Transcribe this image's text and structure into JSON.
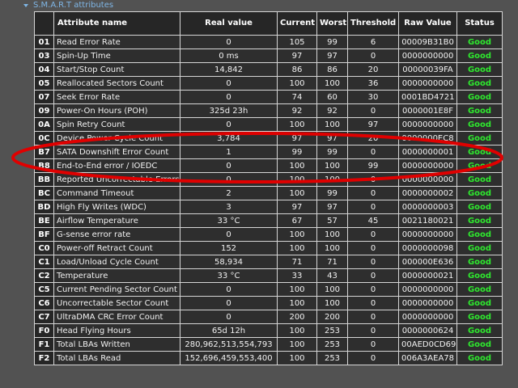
{
  "section": {
    "label": "S.M.A.R.T attributes"
  },
  "table": {
    "headers": {
      "attribute": "Attribute name",
      "real_value": "Real value",
      "current": "Current",
      "worst": "Worst",
      "threshold": "Threshold",
      "raw_value": "Raw Value",
      "status": "Status"
    },
    "rows": [
      {
        "id": "01",
        "name": "Read Error Rate",
        "real": "0",
        "current": "105",
        "worst": "99",
        "threshold": "6",
        "raw": "00009B31B0",
        "status": "Good"
      },
      {
        "id": "03",
        "name": "Spin-Up Time",
        "real": "0 ms",
        "current": "97",
        "worst": "97",
        "threshold": "0",
        "raw": "0000000000",
        "status": "Good"
      },
      {
        "id": "04",
        "name": "Start/Stop Count",
        "real": "14,842",
        "current": "86",
        "worst": "86",
        "threshold": "20",
        "raw": "00000039FA",
        "status": "Good"
      },
      {
        "id": "05",
        "name": "Reallocated Sectors Count",
        "real": "0",
        "current": "100",
        "worst": "100",
        "threshold": "36",
        "raw": "0000000000",
        "status": "Good"
      },
      {
        "id": "07",
        "name": "Seek Error Rate",
        "real": "0",
        "current": "74",
        "worst": "60",
        "threshold": "30",
        "raw": "0001BD4721",
        "status": "Good"
      },
      {
        "id": "09",
        "name": "Power-On Hours (POH)",
        "real": "325d 23h",
        "current": "92",
        "worst": "92",
        "threshold": "0",
        "raw": "0000001E8F",
        "status": "Good"
      },
      {
        "id": "0A",
        "name": "Spin Retry Count",
        "real": "0",
        "current": "100",
        "worst": "100",
        "threshold": "97",
        "raw": "0000000000",
        "status": "Good"
      },
      {
        "id": "0C",
        "name": "Device Power Cycle Count",
        "real": "3,784",
        "current": "97",
        "worst": "97",
        "threshold": "20",
        "raw": "0000000EC8",
        "status": "Good"
      },
      {
        "id": "B7",
        "name": "SATA Downshift Error Count",
        "real": "1",
        "current": "99",
        "worst": "99",
        "threshold": "0",
        "raw": "0000000001",
        "status": "Good"
      },
      {
        "id": "B8",
        "name": "End-to-End error / IOEDC",
        "real": "0",
        "current": "100",
        "worst": "100",
        "threshold": "99",
        "raw": "0000000000",
        "status": "Good"
      },
      {
        "id": "BB",
        "name": "Reported Uncorrectable Errors",
        "real": "0",
        "current": "100",
        "worst": "100",
        "threshold": "0",
        "raw": "0000000000",
        "status": "Good"
      },
      {
        "id": "BC",
        "name": "Command Timeout",
        "real": "2",
        "current": "100",
        "worst": "99",
        "threshold": "0",
        "raw": "0000000002",
        "status": "Good"
      },
      {
        "id": "BD",
        "name": "High Fly Writes (WDC)",
        "real": "3",
        "current": "97",
        "worst": "97",
        "threshold": "0",
        "raw": "0000000003",
        "status": "Good"
      },
      {
        "id": "BE",
        "name": "Airflow Temperature",
        "real": "33 °C",
        "current": "67",
        "worst": "57",
        "threshold": "45",
        "raw": "0021180021",
        "status": "Good"
      },
      {
        "id": "BF",
        "name": "G-sense error rate",
        "real": "0",
        "current": "100",
        "worst": "100",
        "threshold": "0",
        "raw": "0000000000",
        "status": "Good"
      },
      {
        "id": "C0",
        "name": "Power-off Retract Count",
        "real": "152",
        "current": "100",
        "worst": "100",
        "threshold": "0",
        "raw": "0000000098",
        "status": "Good"
      },
      {
        "id": "C1",
        "name": "Load/Unload Cycle Count",
        "real": "58,934",
        "current": "71",
        "worst": "71",
        "threshold": "0",
        "raw": "000000E636",
        "status": "Good"
      },
      {
        "id": "C2",
        "name": "Temperature",
        "real": "33 °C",
        "current": "33",
        "worst": "43",
        "threshold": "0",
        "raw": "0000000021",
        "status": "Good"
      },
      {
        "id": "C5",
        "name": "Current Pending Sector Count",
        "real": "0",
        "current": "100",
        "worst": "100",
        "threshold": "0",
        "raw": "0000000000",
        "status": "Good"
      },
      {
        "id": "C6",
        "name": "Uncorrectable Sector Count",
        "real": "0",
        "current": "100",
        "worst": "100",
        "threshold": "0",
        "raw": "0000000000",
        "status": "Good"
      },
      {
        "id": "C7",
        "name": "UltraDMA CRC Error Count",
        "real": "0",
        "current": "200",
        "worst": "200",
        "threshold": "0",
        "raw": "0000000000",
        "status": "Good"
      },
      {
        "id": "F0",
        "name": "Head Flying Hours",
        "real": "65d 12h",
        "current": "100",
        "worst": "253",
        "threshold": "0",
        "raw": "0000000624",
        "status": "Good"
      },
      {
        "id": "F1",
        "name": "Total LBAs Written",
        "real": "280,962,513,554,793",
        "current": "100",
        "worst": "253",
        "threshold": "0",
        "raw": "00AED0CD69",
        "status": "Good"
      },
      {
        "id": "F2",
        "name": "Total LBAs Read",
        "real": "152,696,459,553,400",
        "current": "100",
        "worst": "253",
        "threshold": "0",
        "raw": "006A3AEA78",
        "status": "Good"
      }
    ]
  },
  "colors": {
    "status_good": "#2ee82e",
    "annotation": "#e00000",
    "section_link": "#7fb6e6"
  }
}
